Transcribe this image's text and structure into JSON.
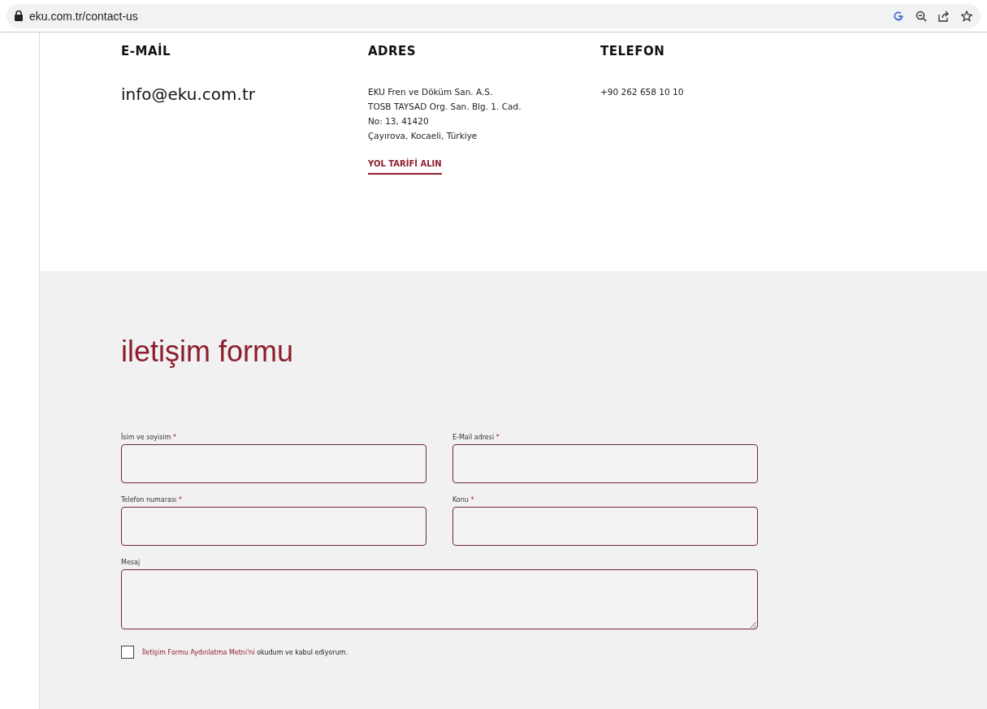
{
  "browser": {
    "url": "eku.com.tr/contact-us"
  },
  "contacts": [
    {
      "heading": "E-MAİL",
      "kind": "big",
      "lines": [
        "info@eku.com.tr"
      ]
    },
    {
      "heading": "ADRES",
      "kind": "small",
      "lines": [
        "EKU Fren ve Döküm San. A.S.",
        "TOSB TAYSAD Org. San. Blg. 1. Cad.",
        "No: 13, 41420",
        "Çayırova, Kocaeli, Türkiye"
      ],
      "link": "YOL TARİFİ ALIN"
    },
    {
      "heading": "TELEFON",
      "kind": "small",
      "lines": [
        "+90 262 658 10 10"
      ]
    }
  ],
  "form": {
    "title": "iletişim formu",
    "fields": [
      {
        "label": "İsim ve soyisim",
        "mark": "*",
        "kind": "input"
      },
      {
        "label": "E-Mail adresi",
        "mark": "*",
        "kind": "input"
      },
      {
        "label": "Telefon numarası",
        "mark": "*",
        "kind": "input"
      },
      {
        "label": "Konu",
        "mark": "*",
        "kind": "input"
      },
      {
        "label": "Mesaj",
        "kind": "textarea"
      }
    ],
    "consent": {
      "checked": false,
      "link": "İletişim Formu Aydınlatma Metni'ni",
      "text": "okudum ve kabul ediyorum."
    }
  }
}
